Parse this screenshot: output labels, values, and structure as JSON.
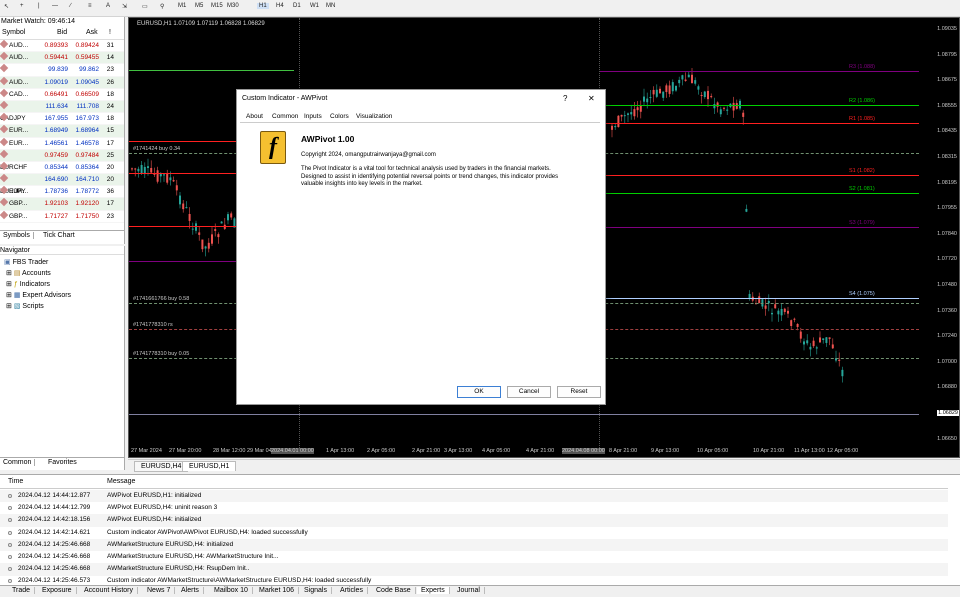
{
  "toolbar": {
    "timeframes": [
      "M1",
      "M5",
      "M15",
      "M30",
      "H1",
      "H4",
      "D1",
      "W1",
      "MN"
    ]
  },
  "market_watch": {
    "title": "Market Watch: 09:46:14",
    "headers": {
      "symbol": "Symbol",
      "bid": "Bid",
      "ask": "Ask",
      "spread": "!"
    },
    "rows": [
      {
        "symbol": "AUD...",
        "bid": "0.89393",
        "ask": "0.89424",
        "spread": "31",
        "bid_color": "#c00000"
      },
      {
        "symbol": "AUD...",
        "bid": "0.59441",
        "ask": "0.59455",
        "spread": "14",
        "bid_color": "#c00000"
      },
      {
        "symbol": "AUDJPY",
        "bid": "99.839",
        "ask": "99.862",
        "spread": "23",
        "bid_color": "#0030c0"
      },
      {
        "symbol": "AUD...",
        "bid": "1.09019",
        "ask": "1.09045",
        "spread": "26",
        "bid_color": "#0030c0"
      },
      {
        "symbol": "CAD...",
        "bid": "0.66491",
        "ask": "0.66509",
        "spread": "18",
        "bid_color": "#c00000"
      },
      {
        "symbol": "CADJPY",
        "bid": "111.634",
        "ask": "111.708",
        "spread": "24",
        "bid_color": "#0030c0"
      },
      {
        "symbol": "CHFJPY",
        "bid": "167.955",
        "ask": "167.973",
        "spread": "18",
        "bid_color": "#0030c0"
      },
      {
        "symbol": "EUR...",
        "bid": "1.68949",
        "ask": "1.68964",
        "spread": "15",
        "bid_color": "#0030c0"
      },
      {
        "symbol": "EUR...",
        "bid": "1.46561",
        "ask": "1.46578",
        "spread": "17",
        "bid_color": "#0030c0"
      },
      {
        "symbol": "EURCHF",
        "bid": "0.97459",
        "ask": "0.97484",
        "spread": "25",
        "bid_color": "#c00000"
      },
      {
        "symbol": "EURGBP",
        "bid": "0.85344",
        "ask": "0.85364",
        "spread": "20",
        "bid_color": "#0030c0"
      },
      {
        "symbol": "EURJPY",
        "bid": "164.690",
        "ask": "164.710",
        "spread": "20",
        "bid_color": "#0030c0"
      },
      {
        "symbol": "EUR...",
        "bid": "1.78736",
        "ask": "1.78772",
        "spread": "36",
        "bid_color": "#0030c0"
      },
      {
        "symbol": "GBP...",
        "bid": "1.92103",
        "ask": "1.92120",
        "spread": "17",
        "bid_color": "#c00000"
      },
      {
        "symbol": "GBP...",
        "bid": "1.71727",
        "ask": "1.71750",
        "spread": "23",
        "bid_color": "#c00000"
      }
    ],
    "tabs": [
      "Symbols",
      "Tick Chart"
    ]
  },
  "navigator": {
    "title": "Navigator",
    "items": [
      "FBS Trader",
      "Accounts",
      "Indicators",
      "Expert Advisors",
      "Scripts"
    ],
    "tabs": [
      "Common",
      "Favorites"
    ]
  },
  "chart": {
    "title": "EURUSD,H1  1.07109 1.07119 1.06828 1.06829",
    "y_ticks": [
      "1.09035",
      "1.08795",
      "1.08675",
      "1.08555",
      "1.08435",
      "1.08315",
      "1.08195",
      "1.07955",
      "1.07840",
      "1.07720",
      "1.07480",
      "1.07360",
      "1.07240",
      "1.07000",
      "1.06880",
      "1.06765",
      "1.06650"
    ],
    "current_price": "1.06829",
    "x_ticks": [
      "27 Mar 2024",
      "27 Mar 20:00",
      "28 Mar 12:00",
      "29 Mar 04:00",
      "2024.04.01 00:00",
      "1 Apr 13:00",
      "2 Apr 05:00",
      "2 Apr 21:00",
      "3 Apr 13:00",
      "4 Apr 05:00",
      "4 Apr 21:00",
      "2024.04.08 00:00",
      "8 Apr 21:00",
      "9 Apr 13:00",
      "10 Apr 05:00",
      "10 Apr 21:00",
      "11 Apr 13:00",
      "12 Apr 05:00"
    ],
    "pivot_labels": [
      {
        "text": "R3 (1.088)",
        "color": "#800080"
      },
      {
        "text": "R2 (1.086)",
        "color": "#00d000"
      },
      {
        "text": "R1 (1.085)",
        "color": "#ff2020"
      },
      {
        "text": "S1 (1.082)",
        "color": "#ff2020"
      },
      {
        "text": "S2 (1.081)",
        "color": "#00d000"
      },
      {
        "text": "S3 (1.079)",
        "color": "#800080"
      },
      {
        "text": "S4 (1.075)",
        "color": "#b0d0ff"
      }
    ],
    "trade_labels": [
      "#1741424 buy 0.34",
      "#1741661766 buy 0.58",
      "#1741778310 rs",
      "#1741778310 buy 0.05"
    ]
  },
  "chart_tabs": [
    "EURUSD,H4",
    "EURUSD,H1"
  ],
  "dialog": {
    "title": "Custom Indicator - AWPivot",
    "help": "?",
    "close": "✕",
    "tabs": [
      "About",
      "Common",
      "Inputs",
      "Colors",
      "Visualization"
    ],
    "indicator_name": "AWPivot 1.00",
    "copyright": "Copyright 2024, omangputrairwanjaya@gmail.com",
    "description": "The Pivot Indicator is a vital tool for technical analysis used by traders in the financial markets. Designed to assist in identifying potential reversal points or trend changes, this indicator provides valuable insights into key levels in the market.",
    "buttons": {
      "ok": "OK",
      "cancel": "Cancel",
      "reset": "Reset"
    }
  },
  "terminal": {
    "headers": {
      "time": "Time",
      "message": "Message"
    },
    "rows": [
      {
        "time": "2024.04.12 14:44:12.877",
        "message": "AWPivot EURUSD,H1: initialized"
      },
      {
        "time": "2024.04.12 14:44:12.799",
        "message": "AWPivot EURUSD,H4: uninit reason 3"
      },
      {
        "time": "2024.04.12 14:42:18.156",
        "message": "AWPivot EURUSD,H4: initialized"
      },
      {
        "time": "2024.04.12 14:42:14.621",
        "message": "Custom indicator AWPivot\\AWPivot EURUSD,H4: loaded successfully"
      },
      {
        "time": "2024.04.12 14:25:46.668",
        "message": "AWMarketStructure EURUSD,H4: initialized"
      },
      {
        "time": "2024.04.12 14:25:46.668",
        "message": "AWMarketStructure EURUSD,H4: AWMarketStructure Init..."
      },
      {
        "time": "2024.04.12 14:25:46.668",
        "message": "AWMarketStructure EURUSD,H4: RsupDem Init.."
      },
      {
        "time": "2024.04.12 14:25:46.573",
        "message": "Custom indicator AWMarketStructure\\AWMarketStructure EURUSD,H4: loaded successfully"
      }
    ],
    "tabs": [
      "Trade",
      "Exposure",
      "Account History",
      "News 7",
      "Alerts",
      "Mailbox 10",
      "Market 106",
      "Signals",
      "Articles",
      "Code Base",
      "Experts",
      "Journal"
    ]
  }
}
